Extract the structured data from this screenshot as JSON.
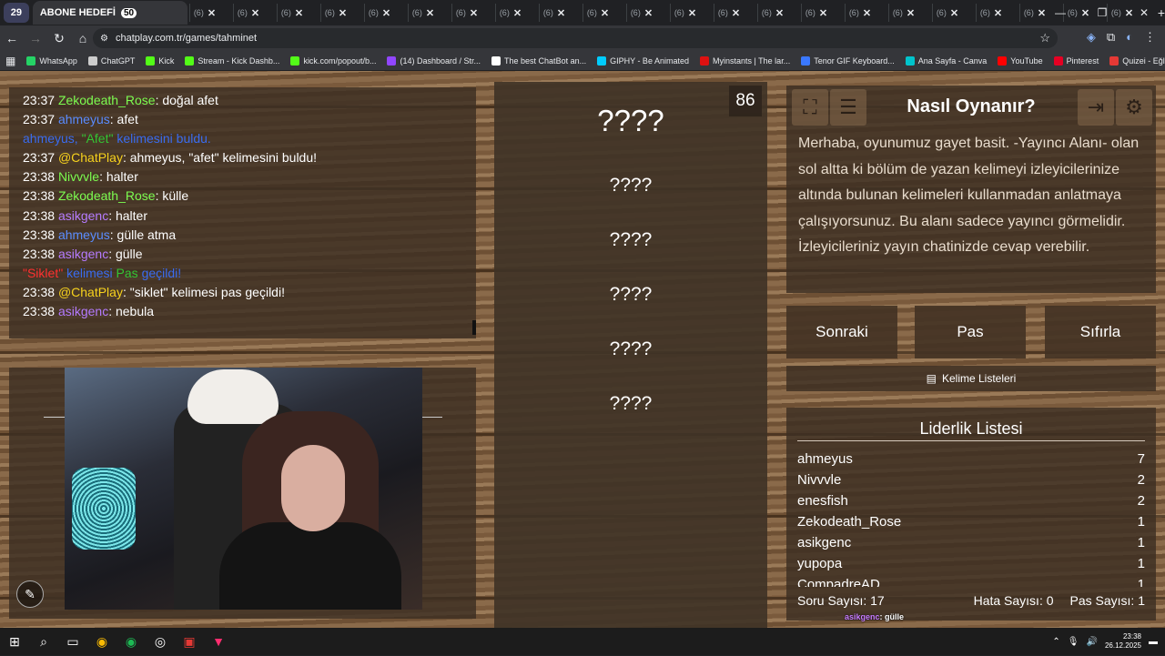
{
  "browser": {
    "tab_group_count": "29",
    "active_tab": {
      "title": "ABONE HEDEFİ",
      "badge": "50"
    },
    "other_tabs": [
      "(6)",
      "(6)",
      "(6)",
      "(6)",
      "(6)",
      "(6)",
      "(6)",
      "(6)",
      "(6)",
      "(6)",
      "(6)",
      "(6)",
      "(6)",
      "(6)",
      "(6)",
      "(6)",
      "(6)",
      "(6)",
      "(6)",
      "(6)",
      "(6)",
      "(6)"
    ],
    "tab_close": "✕",
    "new_tab": "+",
    "url": "chatplay.com.tr/games/tahminet",
    "bookmarks": [
      {
        "label": "WhatsApp",
        "color": "#25d366"
      },
      {
        "label": "ChatGPT",
        "color": "#cccccc"
      },
      {
        "label": "Kick",
        "color": "#53fc18"
      },
      {
        "label": "Stream - Kick Dashb...",
        "color": "#53fc18"
      },
      {
        "label": "kick.com/popout/b...",
        "color": "#53fc18"
      },
      {
        "label": "(14) Dashboard / Str...",
        "color": "#9146ff"
      },
      {
        "label": "The best ChatBot an...",
        "color": "#ffffff"
      },
      {
        "label": "GIPHY - Be Animated",
        "color": "#00ccff"
      },
      {
        "label": "Myinstants | The lar...",
        "color": "#d11"
      },
      {
        "label": "Tenor GIF Keyboard...",
        "color": "#3a78ff"
      },
      {
        "label": "Ana Sayfa - Canva",
        "color": "#00c4cc"
      },
      {
        "label": "YouTube",
        "color": "#ff0000"
      },
      {
        "label": "Pinterest",
        "color": "#e60023"
      },
      {
        "label": "Quizei - Eğlenceli ve...",
        "color": "#e53935"
      }
    ]
  },
  "chat": [
    {
      "time": "23:37",
      "user": "Zekodeath_Rose",
      "ucolor": "u-green",
      "msg": "doğal afet"
    },
    {
      "time": "23:37",
      "user": "ahmeyus",
      "ucolor": "u-blue",
      "msg": "afet"
    },
    {
      "system": "found",
      "user": "ahmeyus,",
      "word": "\"Afet\"",
      "rest": "kelimesini buldu."
    },
    {
      "time": "23:37",
      "user": "@ChatPlay",
      "ucolor": "u-cp",
      "msg": "ahmeyus, \"afet\" kelimesini buldu!"
    },
    {
      "time": "23:38",
      "user": "Nivvvle",
      "ucolor": "u-green",
      "msg": "halter"
    },
    {
      "time": "23:38",
      "user": "Zekodeath_Rose",
      "ucolor": "u-green",
      "msg": "külle"
    },
    {
      "time": "23:38",
      "user": "asikgenc",
      "ucolor": "u-purple",
      "msg": "halter"
    },
    {
      "time": "23:38",
      "user": "ahmeyus",
      "ucolor": "u-blue",
      "msg": "gülle atma"
    },
    {
      "time": "23:38",
      "user": "asikgenc",
      "ucolor": "u-purple",
      "msg": "gülle"
    },
    {
      "system": "pass",
      "word": "\"Siklet\"",
      "mid": "kelimesi",
      "pas": "Pas",
      "rest": "geçildi!"
    },
    {
      "time": "23:38",
      "user": "@ChatPlay",
      "ucolor": "u-cp",
      "msg": "\"siklet\" kelimesi pas geçildi!"
    },
    {
      "time": "23:38",
      "user": "asikgenc",
      "ucolor": "u-purple",
      "msg": "nebula"
    }
  ],
  "game": {
    "counter": "86",
    "words": [
      "????",
      "????",
      "????",
      "????",
      "????",
      "????"
    ]
  },
  "howto": {
    "title": "Nasıl Oynanır?",
    "text": "Merhaba, oyunumuz gayet basit. -Yayıncı Alanı- olan sol altta ki bölüm de yazan kelimeyi izleyicilerinize altında bulunan kelimeleri kullanmadan anlatmaya çalışıyorsunuz. Bu alanı sadece yayıncı görmelidir. İzleyicileriniz yayın chatinizde cevap verebilir."
  },
  "buttons": {
    "next": "Sonraki",
    "pass": "Pas",
    "reset": "Sıfırla"
  },
  "lists_button": "Kelime Listeleri",
  "leaderboard": {
    "title": "Liderlik Listesi",
    "rows": [
      {
        "name": "ahmeyus",
        "score": "7"
      },
      {
        "name": "Nivvvle",
        "score": "2"
      },
      {
        "name": "enesfish",
        "score": "2"
      },
      {
        "name": "Zekodeath_Rose",
        "score": "1"
      },
      {
        "name": "asikgenc",
        "score": "1"
      },
      {
        "name": "yupopa",
        "score": "1"
      },
      {
        "name": "CompadreAD",
        "score": "1"
      }
    ],
    "questions": "Soru Sayısı: 17",
    "errors": "Hata Sayısı: 0",
    "passes": "Pas Sayısı: 1"
  },
  "overlay_chat": [
    {
      "user": "asikgenc",
      "msg": ": gülle"
    },
    {
      "user": "@ChatPlay",
      "msg": ": \"siklet\" kelimesi pas geçildi!"
    },
    {
      "user": "asikgenc",
      "msg": ": nebula"
    }
  ],
  "taskbar": {
    "time": "23:38",
    "date": "26.12.2025"
  }
}
